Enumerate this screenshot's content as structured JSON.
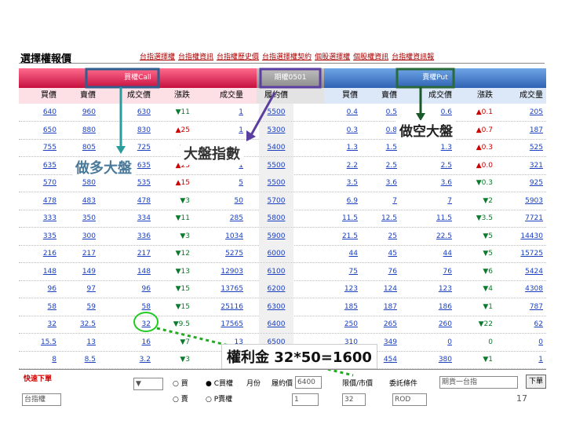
{
  "page": {
    "title": "選擇權報價",
    "nav_links": [
      "台指選擇權",
      "台指權資訊",
      "台指權歷史價",
      "台指選擇權契約",
      "個股選擇權",
      "個股權資訊",
      "台指權資訊報"
    ]
  },
  "headers": {
    "call": "買權Call",
    "futures": "期權0501",
    "put": "賣權Put"
  },
  "columns": {
    "call": [
      "買價",
      "賣價",
      "成交價",
      "漲跌",
      "成交量"
    ],
    "strike": "履約價",
    "put": [
      "買價",
      "賣價",
      "成交價",
      "漲跌",
      "成交量"
    ]
  },
  "rows": [
    {
      "c_bid": "640",
      "c_ask": "960",
      "c_last": "630",
      "c_chg": "▼11",
      "c_vol": "1",
      "strike": "5500",
      "p_bid": "0.4",
      "p_ask": "0.5",
      "p_last": "0.6",
      "p_chg": "▲0.1",
      "p_vol": "205"
    },
    {
      "c_bid": "650",
      "c_ask": "880",
      "c_last": "830",
      "c_chg": "▲25",
      "c_vol": "1",
      "strike": "5300",
      "p_bid": "0.3",
      "p_ask": "0.8",
      "p_last": "0.4",
      "p_chg": "▲0.7",
      "p_vol": "187"
    },
    {
      "c_bid": "755",
      "c_ask": "805",
      "c_last": "725",
      "c_chg": "▼5",
      "c_vol": "3",
      "strike": "5400",
      "p_bid": "1.3",
      "p_ask": "1.5",
      "p_last": "1.3",
      "p_chg": "▲0.3",
      "p_vol": "525"
    },
    {
      "c_bid": "635",
      "c_ask": "635",
      "c_last": "635",
      "c_chg": "▲25",
      "c_vol": "1",
      "strike": "5500",
      "p_bid": "2.2",
      "p_ask": "2.5",
      "p_last": "2.5",
      "p_chg": "▲0.0",
      "p_vol": "321"
    },
    {
      "c_bid": "570",
      "c_ask": "580",
      "c_last": "535",
      "c_chg": "▲15",
      "c_vol": "5",
      "strike": "5500",
      "p_bid": "3.5",
      "p_ask": "3.6",
      "p_last": "3.6",
      "p_chg": "▼0.3",
      "p_vol": "925"
    },
    {
      "c_bid": "478",
      "c_ask": "483",
      "c_last": "478",
      "c_chg": "▼3",
      "c_vol": "50",
      "strike": "5700",
      "p_bid": "6.9",
      "p_ask": "7",
      "p_last": "7",
      "p_chg": "▼2",
      "p_vol": "5903"
    },
    {
      "c_bid": "333",
      "c_ask": "350",
      "c_last": "334",
      "c_chg": "▼11",
      "c_vol": "285",
      "strike": "5800",
      "p_bid": "11.5",
      "p_ask": "12.5",
      "p_last": "11.5",
      "p_chg": "▼3.5",
      "p_vol": "7721"
    },
    {
      "c_bid": "335",
      "c_ask": "300",
      "c_last": "336",
      "c_chg": "▼3",
      "c_vol": "1034",
      "strike": "5900",
      "p_bid": "21.5",
      "p_ask": "25",
      "p_last": "22.5",
      "p_chg": "▼5",
      "p_vol": "14430"
    },
    {
      "c_bid": "216",
      "c_ask": "217",
      "c_last": "217",
      "c_chg": "▼12",
      "c_vol": "5275",
      "strike": "6000",
      "p_bid": "44",
      "p_ask": "45",
      "p_last": "44",
      "p_chg": "▼5",
      "p_vol": "15725"
    },
    {
      "c_bid": "148",
      "c_ask": "149",
      "c_last": "148",
      "c_chg": "▼13",
      "c_vol": "12903",
      "strike": "6100",
      "p_bid": "75",
      "p_ask": "76",
      "p_last": "76",
      "p_chg": "▼6",
      "p_vol": "5424"
    },
    {
      "c_bid": "96",
      "c_ask": "97",
      "c_last": "96",
      "c_chg": "▼15",
      "c_vol": "13765",
      "strike": "6200",
      "p_bid": "123",
      "p_ask": "124",
      "p_last": "123",
      "p_chg": "▼4",
      "p_vol": "4308"
    },
    {
      "c_bid": "58",
      "c_ask": "59",
      "c_last": "58",
      "c_chg": "▼15",
      "c_vol": "25116",
      "strike": "6300",
      "p_bid": "185",
      "p_ask": "187",
      "p_last": "186",
      "p_chg": "▼1",
      "p_vol": "787"
    },
    {
      "c_bid": "32",
      "c_ask": "32.5",
      "c_last": "32",
      "c_chg": "▼9.5",
      "c_vol": "17565",
      "strike": "6400",
      "p_bid": "250",
      "p_ask": "265",
      "p_last": "260",
      "p_chg": "▼22",
      "p_vol": "62"
    },
    {
      "c_bid": "15.5",
      "c_ask": "13",
      "c_last": "16",
      "c_chg": "▼7",
      "c_vol": "13",
      "strike": "6500",
      "p_bid": "310",
      "p_ask": "349",
      "p_last": "0",
      "p_chg": "0",
      "p_vol": "0"
    },
    {
      "c_bid": "8",
      "c_ask": "8.5",
      "c_last": "3.2",
      "c_chg": "▼3",
      "c_vol": "49",
      "strike": "6600",
      "p_bid": "398",
      "p_ask": "454",
      "p_last": "380",
      "p_chg": "▼1",
      "p_vol": "1"
    }
  ],
  "annotations": {
    "long_index": "做多大盤",
    "short_index": "做空大盤",
    "index": "大盤指數",
    "premium": "權利金 32*50=1600"
  },
  "order_panel": {
    "title": "快速下單",
    "account": "台指權",
    "side_buy": "買",
    "side_sell": "賣",
    "call_label": "C買權",
    "put_label": "P賣權",
    "month_label": "月份",
    "strike_label": "履約價",
    "strike_value": "6400",
    "price_label": "限價/市價",
    "price_value": "32",
    "cond_label": "委託條件",
    "cond_value": "ROD",
    "qty_value": "1",
    "product_label": "期貨一台指",
    "submit_label": "下單",
    "page_num": "17"
  },
  "colors": {
    "call_header": "#c6103f",
    "put_header": "#2f62b4",
    "annotation_blue": "#2f5f8f",
    "annotation_green": "#2a9c3a",
    "annotation_purple": "#5b3fa0"
  }
}
